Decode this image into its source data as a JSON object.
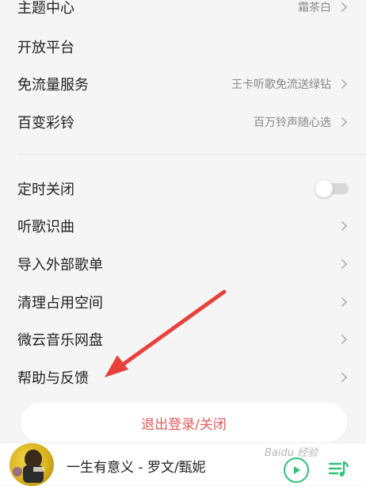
{
  "settings": {
    "theme": {
      "label": "主题中心",
      "value": "霜茶白"
    },
    "open_platform": {
      "label": "开放平台"
    },
    "free_data": {
      "label": "免流量服务",
      "value": "王卡听歌免流送绿钻"
    },
    "ringtone": {
      "label": "百变彩铃",
      "value": "百万铃声随心选"
    },
    "timer": {
      "label": "定时关闭",
      "enabled": false
    },
    "recognize": {
      "label": "听歌识曲"
    },
    "import_playlist": {
      "label": "导入外部歌单"
    },
    "clean_storage": {
      "label": "清理占用空间"
    },
    "weiyun": {
      "label": "微云音乐网盘"
    },
    "help": {
      "label": "帮助与反馈"
    }
  },
  "logout": {
    "label": "退出登录/关闭"
  },
  "player": {
    "song_title": "一生有意义 - 罗文/甄妮",
    "cover_icon": "album-cover"
  },
  "watermark": {
    "text": "Baidu 经验"
  },
  "colors": {
    "accent_green": "#31c27c",
    "logout_red": "#e55a5a",
    "annotation_arrow": "#e8413c"
  }
}
